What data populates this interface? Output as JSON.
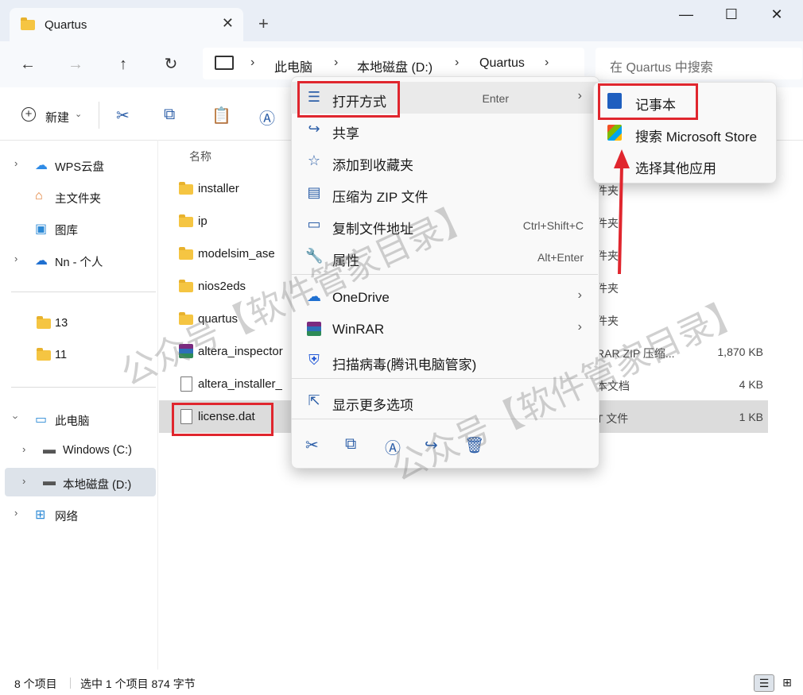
{
  "window": {
    "tab_title": "Quartus",
    "tab_close": "✕",
    "new_tab": "+",
    "minimize": "—",
    "maximize": "☐",
    "close": "✕"
  },
  "nav": {
    "back": "←",
    "forward": "→",
    "up": "↑",
    "refresh": "↻",
    "breadcrumb": [
      "此电脑",
      "本地磁盘 (D:)",
      "Quartus"
    ],
    "search_placeholder": "在 Quartus 中搜索"
  },
  "toolbar": {
    "new_label": "新建"
  },
  "sidebar": {
    "items": [
      {
        "label": "WPS云盘",
        "icon": "cloud-icon"
      },
      {
        "label": "主文件夹",
        "icon": "home-icon"
      },
      {
        "label": "图库",
        "icon": "gallery-icon"
      },
      {
        "label": "Nn - 个人",
        "icon": "onedrive-icon"
      },
      {
        "label": "13",
        "icon": "folder-icon"
      },
      {
        "label": "11",
        "icon": "folder-icon"
      },
      {
        "label": "此电脑",
        "icon": "pc-icon"
      },
      {
        "label": "Windows (C:)",
        "icon": "drive-icon"
      },
      {
        "label": "本地磁盘 (D:)",
        "icon": "drive-icon",
        "selected": true
      },
      {
        "label": "网络",
        "icon": "network-icon"
      }
    ]
  },
  "files": {
    "column_name": "名称",
    "rows": [
      {
        "name": "installer",
        "type": "件夹",
        "size": ""
      },
      {
        "name": "ip",
        "type": "件夹",
        "size": ""
      },
      {
        "name": "modelsim_ase",
        "type": "件夹",
        "size": ""
      },
      {
        "name": "nios2eds",
        "type": "件夹",
        "size": ""
      },
      {
        "name": "quartus",
        "type": "件夹",
        "size": ""
      },
      {
        "name": "altera_inspector",
        "type": "RAR ZIP 压缩...",
        "size": "1,870 KB"
      },
      {
        "name": "altera_installer_",
        "type": "本文档",
        "size": "4 KB"
      },
      {
        "name": "license.dat",
        "type": "T 文件",
        "size": "1 KB"
      }
    ]
  },
  "context_menu": {
    "items": [
      {
        "label": "打开方式",
        "key": "Enter",
        "arrow": true
      },
      {
        "label": "共享",
        "key": ""
      },
      {
        "label": "添加到收藏夹",
        "key": ""
      },
      {
        "label": "压缩为 ZIP 文件",
        "key": ""
      },
      {
        "label": "复制文件地址",
        "key": "Ctrl+Shift+C"
      },
      {
        "label": "属性",
        "key": "Alt+Enter"
      },
      {
        "label": "OneDrive",
        "key": "",
        "arrow": true
      },
      {
        "label": "WinRAR",
        "key": "",
        "arrow": true
      },
      {
        "label": "扫描病毒(腾讯电脑管家)",
        "key": ""
      },
      {
        "label": "显示更多选项",
        "key": ""
      }
    ],
    "arrow_glyph": "›"
  },
  "submenu": {
    "items": [
      {
        "label": "记事本"
      },
      {
        "label": "搜索 Microsoft Store"
      },
      {
        "label": "选择其他应用"
      }
    ]
  },
  "status": {
    "count": "8 个项目",
    "selection": "选中 1 个项目  874 字节"
  },
  "watermark": {
    "text1": "公众号【软件管家目录】",
    "text2": "公众号【软件管家目录】"
  },
  "colors": {
    "highlight_red": "#e0262e",
    "accent_blue": "#2d5fa8"
  }
}
